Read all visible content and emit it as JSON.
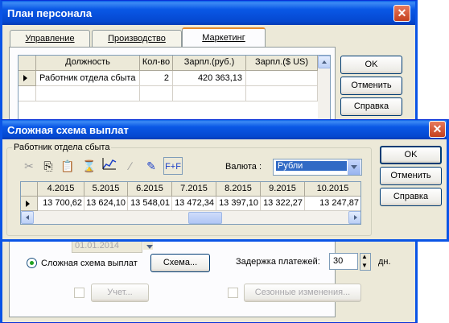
{
  "back_window": {
    "title": "План персонала",
    "tabs": [
      {
        "label": "Управление",
        "active": false
      },
      {
        "label": "Производство",
        "active": false
      },
      {
        "label": "Маркетинг",
        "active": true
      }
    ],
    "table": {
      "columns": [
        "Должность",
        "Кол-во",
        "Зарпл.(руб.)",
        "Зарпл.($ US)"
      ],
      "rows": [
        {
          "position": "Работник отдела сбыта",
          "count": "2",
          "salary_rub": "420 363,13",
          "salary_usd": ""
        }
      ]
    },
    "buttons": {
      "ok": "OK",
      "cancel": "Отменить",
      "help": "Справка"
    },
    "date_field": "01.01.2014",
    "complex_scheme_label": "Сложная схема выплат",
    "scheme_button": "Схема...",
    "delay_label": "Задержка платежей:",
    "delay_value": "30",
    "delay_unit": "дн.",
    "accounting_button": "Учет...",
    "seasonal_button": "Сезонные изменения..."
  },
  "dialog": {
    "title": "Сложная схема выплат",
    "group_title": "Работник отдела сбыта",
    "currency_label": "Валюта :",
    "currency_value": "Рубли",
    "buttons": {
      "ok": "OK",
      "cancel": "Отменить",
      "help": "Справка"
    },
    "toolbar_icons": [
      "scissors-icon",
      "copy-icon",
      "paste-icon",
      "fill-icon",
      "chart-icon",
      "wand-icon",
      "pencil-icon",
      "formula-icon"
    ],
    "table": {
      "columns": [
        "4.2015",
        "5.2015",
        "6.2015",
        "7.2015",
        "8.2015",
        "9.2015",
        "10.2015"
      ],
      "values": [
        "13 700,62",
        "13 624,10",
        "13 548,01",
        "13 472,34",
        "13 397,10",
        "13 322,27",
        "13 247,87"
      ]
    }
  },
  "colors": {
    "title_bar": "#0548d0",
    "window_face": "#ece9d8",
    "close_button": "#c4401e"
  }
}
